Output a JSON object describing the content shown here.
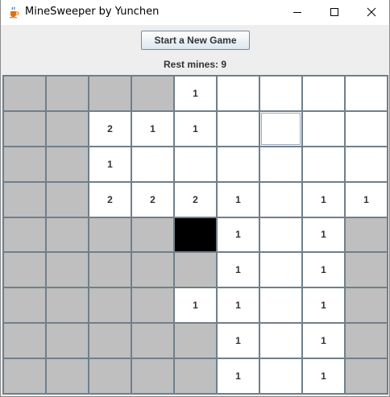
{
  "window": {
    "title": "MineSweeper by Yunchen",
    "icons": {
      "app": "java-cup-icon",
      "minimize": "minimize-icon",
      "maximize": "maximize-icon",
      "close": "close-icon"
    }
  },
  "toolbar": {
    "new_game_label": "Start a New Game"
  },
  "status": {
    "rest_mines": "Rest mines: 9"
  },
  "colors": {
    "hidden_cell": "#bfbfbf",
    "open_cell": "#ffffff",
    "mine_cell": "#000000",
    "grid_line": "#6f7f8c"
  },
  "board": {
    "rows": 9,
    "cols": 9,
    "focused": [
      1,
      6
    ],
    "cells": [
      [
        "H",
        "H",
        "H",
        "H",
        "1",
        "",
        "",
        "",
        ""
      ],
      [
        "H",
        "H",
        "2",
        "1",
        "1",
        "",
        "",
        "",
        ""
      ],
      [
        "H",
        "H",
        "1",
        "",
        "",
        "",
        "",
        "",
        ""
      ],
      [
        "H",
        "H",
        "2",
        "2",
        "2",
        "1",
        "",
        "1",
        "1"
      ],
      [
        "H",
        "H",
        "H",
        "H",
        "M",
        "1",
        "",
        "1",
        "H"
      ],
      [
        "H",
        "H",
        "H",
        "H",
        "H",
        "1",
        "",
        "1",
        "H"
      ],
      [
        "H",
        "H",
        "H",
        "H",
        "1",
        "1",
        "",
        "1",
        "H"
      ],
      [
        "H",
        "H",
        "H",
        "H",
        "H",
        "1",
        "",
        "1",
        "H"
      ],
      [
        "H",
        "H",
        "H",
        "H",
        "H",
        "1",
        "",
        "1",
        "H"
      ]
    ]
  }
}
